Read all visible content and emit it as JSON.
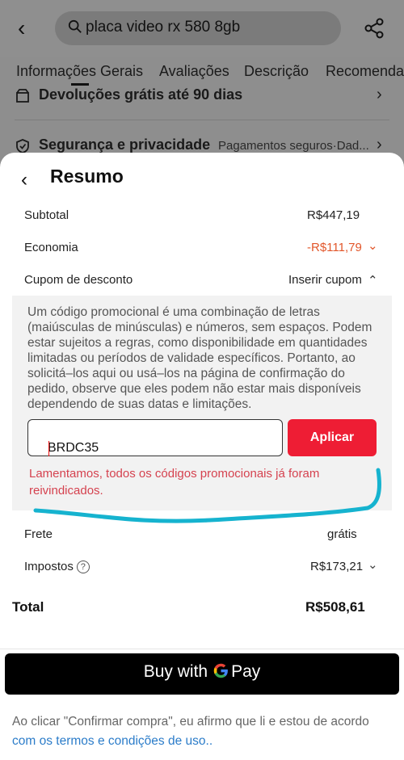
{
  "search": {
    "query": "placa video rx 580 8gb"
  },
  "tabs": [
    {
      "label": "Informações Gerais"
    },
    {
      "label": "Avaliações"
    },
    {
      "label": "Descrição"
    },
    {
      "label": "Recomenda"
    }
  ],
  "background_rows": {
    "returns": {
      "label": "Devoluções grátis até 90 dias"
    },
    "security": {
      "label": "Segurança e privacidade",
      "sub": "Pagamentos seguros·Dad..."
    }
  },
  "summary": {
    "title": "Resumo",
    "subtotal": {
      "label": "Subtotal",
      "value": "R$447,19"
    },
    "savings": {
      "label": "Economia",
      "value": "-R$111,79"
    },
    "coupon": {
      "label": "Cupom de desconto",
      "action": "Inserir cupom",
      "description": "Um código promocional é uma combinação de letras (maiúsculas de minúsculas) e números, sem espaços. Podem estar sujeitos a regras, como disponibilidade em quantidades limitadas ou períodos de validade específicos. Portanto, ao solicitá–los aqui ou usá–los na página de confirmação do pedido, observe que eles podem não estar mais disponíveis dependendo de suas datas e limitações.",
      "input_value": "BRDC35",
      "apply_label": "Aplicar",
      "error": "Lamentamos, todos os códigos promocionais já foram reivindicados."
    },
    "shipping": {
      "label": "Frete",
      "value": "grátis"
    },
    "taxes": {
      "label": "Impostos",
      "value": "R$173,21"
    },
    "total": {
      "label": "Total",
      "value": "R$508,61"
    }
  },
  "payment": {
    "button_prefix": "Buy with",
    "button_suffix": "Pay"
  },
  "terms": {
    "text": "Ao clicar \"Confirmar compra\", eu afirmo que li e estou de acordo",
    "link": "com os termos e condições de uso.."
  },
  "colors": {
    "accent_red": "#ee1d34",
    "savings_orange": "#e2572b",
    "error_red": "#d5424f",
    "annotation_cyan": "#16b3cf",
    "link_blue": "#2b7cc9"
  }
}
